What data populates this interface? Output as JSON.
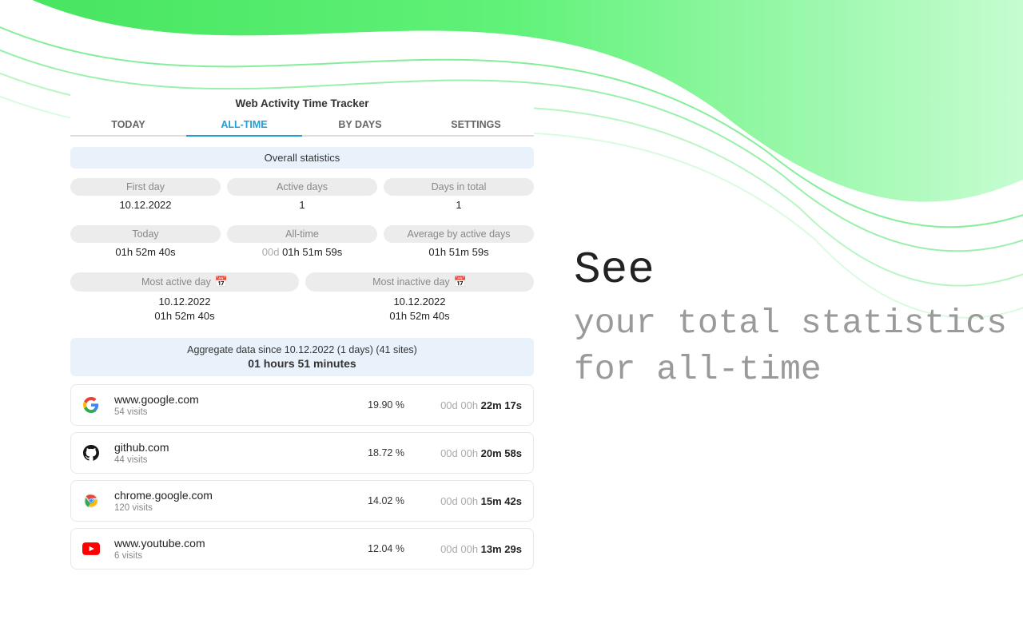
{
  "app_title": "Web Activity Time Tracker",
  "tabs": {
    "today": "TODAY",
    "alltime": "ALL-TIME",
    "bydays": "BY DAYS",
    "settings": "SETTINGS"
  },
  "overall_label": "Overall statistics",
  "stats_row1": {
    "first_day_label": "First day",
    "first_day_value": "10.12.2022",
    "active_days_label": "Active days",
    "active_days_value": "1",
    "days_total_label": "Days in total",
    "days_total_value": "1"
  },
  "stats_row2": {
    "today_label": "Today",
    "today_value": "01h 52m 40s",
    "alltime_label": "All-time",
    "alltime_muted": "00d",
    "alltime_value": " 01h 51m 59s",
    "avg_label": "Average by active days",
    "avg_value": "01h 51m 59s"
  },
  "stats_row3": {
    "most_active_label": "Most active day",
    "most_active_date": "10.12.2022",
    "most_active_time": "01h 52m 40s",
    "most_inactive_label": "Most inactive day",
    "most_inactive_date": "10.12.2022",
    "most_inactive_time": "01h 52m 40s"
  },
  "aggregate": {
    "line1": "Aggregate data since 10.12.2022 (1 days) (41 sites)",
    "line2": "01 hours 51 minutes"
  },
  "sites": [
    {
      "domain": "www.google.com",
      "visits": "54 visits",
      "pct": "19.90 %",
      "time_muted": "00d 00h ",
      "time_strong": "22m 17s",
      "icon": "google"
    },
    {
      "domain": "github.com",
      "visits": "44 visits",
      "pct": "18.72 %",
      "time_muted": "00d 00h ",
      "time_strong": "20m 58s",
      "icon": "github"
    },
    {
      "domain": "chrome.google.com",
      "visits": "120 visits",
      "pct": "14.02 %",
      "time_muted": "00d 00h ",
      "time_strong": "15m 42s",
      "icon": "chrome"
    },
    {
      "domain": "www.youtube.com",
      "visits": "6 visits",
      "pct": "12.04 %",
      "time_muted": "00d 00h ",
      "time_strong": "13m 29s",
      "icon": "youtube"
    }
  ],
  "headline": {
    "big": "See",
    "rest": "your total statistics for all-time"
  }
}
